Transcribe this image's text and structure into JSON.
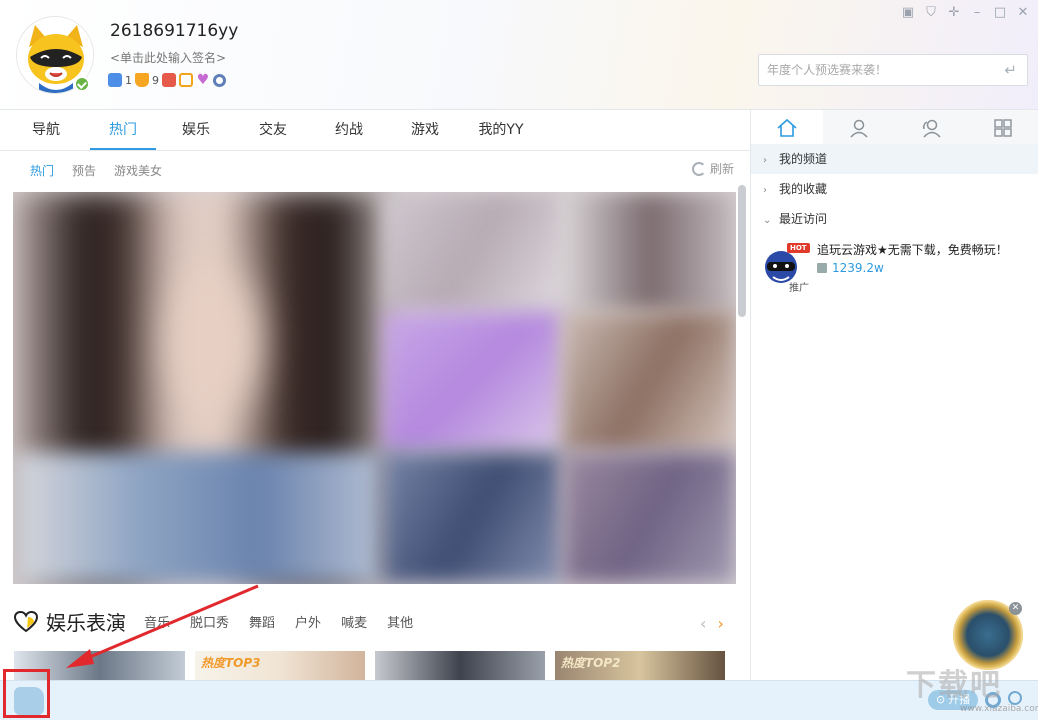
{
  "header": {
    "username": "2618691716yy",
    "signature": "<单击此处输入签名>",
    "badges": [
      {
        "icon": "gamepad-icon",
        "count": "1"
      },
      {
        "icon": "hands-icon",
        "count": "9"
      },
      {
        "icon": "shop-icon"
      },
      {
        "icon": "play-icon"
      },
      {
        "icon": "heart-badge-icon"
      },
      {
        "icon": "eye-icon"
      }
    ],
    "search_placeholder": "年度个人预选赛来袭！",
    "window_controls": [
      "skin-icon",
      "shirt-icon",
      "pin-icon",
      "minimize-icon",
      "maximize-icon",
      "close-icon"
    ]
  },
  "tabs": [
    "导航",
    "热门",
    "娱乐",
    "交友",
    "约战",
    "游戏",
    "我的YY"
  ],
  "active_tab": "热门",
  "subtabs": [
    "热门",
    "预告",
    "游戏美女"
  ],
  "refresh_label": "刷新",
  "section": {
    "title": "娱乐表演",
    "categories": [
      "音乐",
      "脱口秀",
      "舞蹈",
      "户外",
      "喊麦",
      "其他"
    ]
  },
  "thumb_tags": [
    "热度TOP3",
    "热度TOP2"
  ],
  "right_panel": {
    "tabs": [
      "home-icon",
      "user-icon",
      "friends-icon",
      "apps-icon"
    ],
    "sections": [
      {
        "label": "我的频道",
        "expanded": false
      },
      {
        "label": "我的收藏",
        "expanded": false
      },
      {
        "label": "最近访问",
        "expanded": true
      }
    ],
    "recent": {
      "title": "追玩云游戏★无需下载，免费畅玩！",
      "count": "1239.2w",
      "hot": "HOT",
      "promo": "推广"
    }
  },
  "bottom": {
    "live_label": "开播"
  },
  "watermark": {
    "text": "下载吧",
    "url": "www.xiazaiba.com"
  },
  "colors": {
    "accent": "#2e9be0",
    "annotation_red": "#e0282d",
    "orange": "#f19a2c"
  }
}
